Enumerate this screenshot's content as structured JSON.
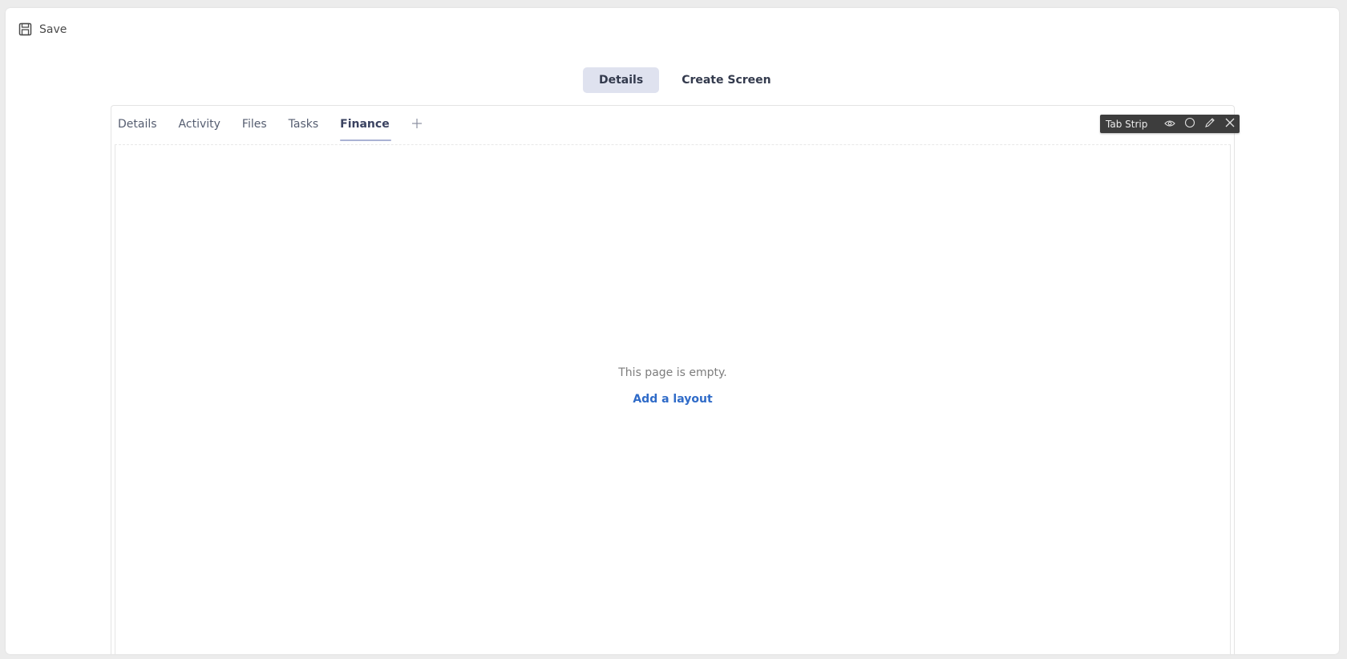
{
  "toolbar": {
    "save_label": "Save"
  },
  "screen_switch": [
    {
      "label": "Details",
      "active": true
    },
    {
      "label": "Create Screen",
      "active": false
    }
  ],
  "tabs": [
    {
      "label": "Details"
    },
    {
      "label": "Activity"
    },
    {
      "label": "Files"
    },
    {
      "label": "Tasks"
    },
    {
      "label": "Finance",
      "active": true
    }
  ],
  "component_toolbar": {
    "title": "Tab Strip",
    "icons": [
      "eye-icon",
      "circle-icon",
      "pencil-icon",
      "close-icon"
    ]
  },
  "empty_state": {
    "message": "This page is empty.",
    "action": "Add a layout"
  },
  "colors": {
    "accent": "#2f6bc8",
    "active_switch_bg": "#dfe2ef",
    "tab_underline": "#aab2d4",
    "toolbar_bg": "#3d3d3d"
  }
}
